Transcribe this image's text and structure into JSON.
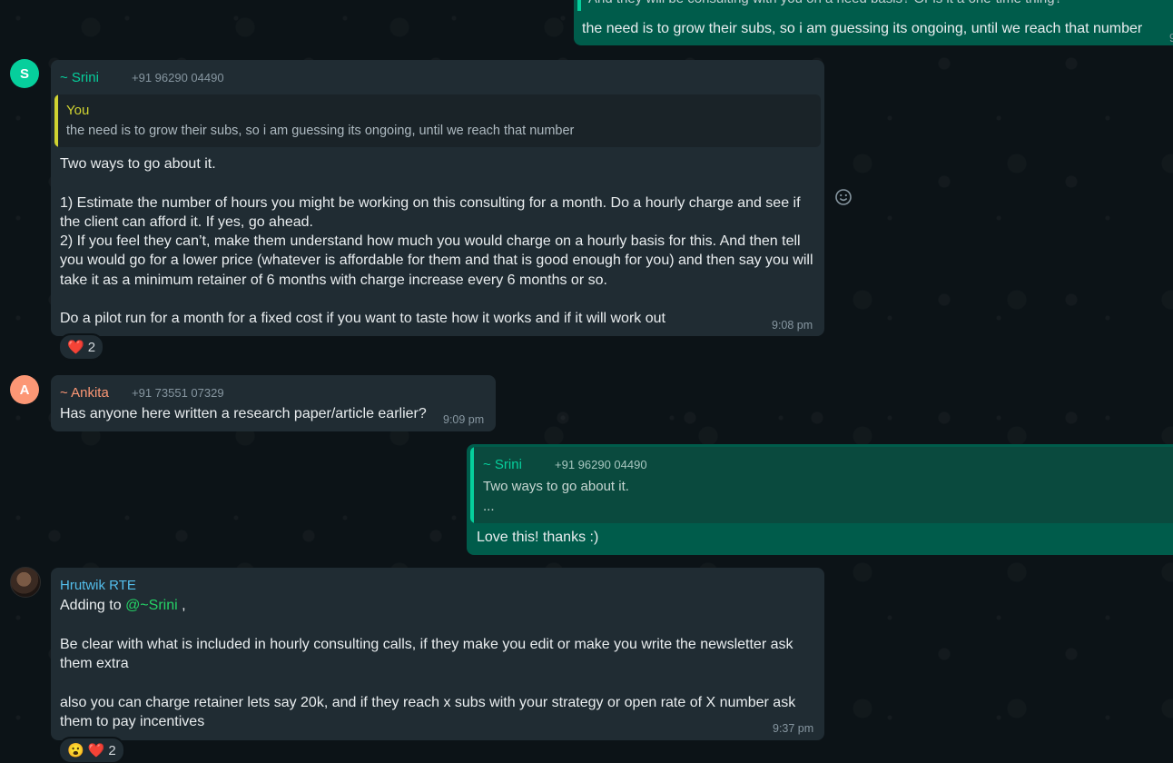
{
  "colors": {
    "background": "#0c1317",
    "incoming_bubble": "#202c33",
    "outgoing_bubble": "#005c4b",
    "srini_name": "#06cf9c",
    "ankita_name": "#fc9775",
    "hrutwik_name": "#53bdeb",
    "you_quote": "#d0d331",
    "mention": "#25d366"
  },
  "top_message": {
    "partial_text": "And they will be consulting with you on a need basis? Or is it a one-time thing?",
    "text": "the need is to grow their subs, so i am guessing its ongoing, until we reach that number",
    "time_partial": "9"
  },
  "msg_srini": {
    "avatar_letter": "S",
    "sender": "~ Srini",
    "phone": "+91 96290 04490",
    "quote_author": "You",
    "quote_text": "the need is to grow their subs, so i am guessing its ongoing, until we reach that number",
    "text": "Two ways to go about it.\n\n1) Estimate the number of hours you might be working on this consulting for a month. Do a hourly charge and see if the client can afford it. If yes, go ahead.\n2) If you feel they can’t, make them understand how much you would charge on a hourly basis for this. And then tell you would go for a lower price (whatever is affordable for them and that is good enough for you) and then say you will take it as a minimum retainer of 6 months with charge increase every 6 months or so.\n\nDo a pilot run for a month for a fixed cost if you want to taste how it works and if it will work out",
    "time": "9:08 pm",
    "reaction_emoji": "❤️",
    "reaction_count": "2"
  },
  "msg_ankita": {
    "avatar_letter": "A",
    "sender": "~ Ankita",
    "phone": "+91 73551 07329",
    "text": "Has anyone here written a research paper/article earlier?",
    "time": "9:09 pm"
  },
  "msg_reply": {
    "quote_author": "~ Srini",
    "quote_phone": "+91 96290 04490",
    "quote_line1": "Two ways to go about it.",
    "quote_line2": "...",
    "text": "Love this! thanks :)"
  },
  "msg_hrutwik": {
    "sender": "Hrutwik RTE",
    "text_prefix": "Adding to ",
    "mention": "@~Srini",
    "text_suffix": " ,",
    "text_body": "Be clear with what is included in hourly consulting calls, if they make you edit or make you write the newsletter ask them extra\n\nalso you can charge retainer lets say 20k, and if they reach x subs with your strategy or open rate of X number ask them to pay incentives",
    "time": "9:37 pm",
    "reaction_emoji1": "😮",
    "reaction_emoji2": "❤️",
    "reaction_count": "2"
  }
}
